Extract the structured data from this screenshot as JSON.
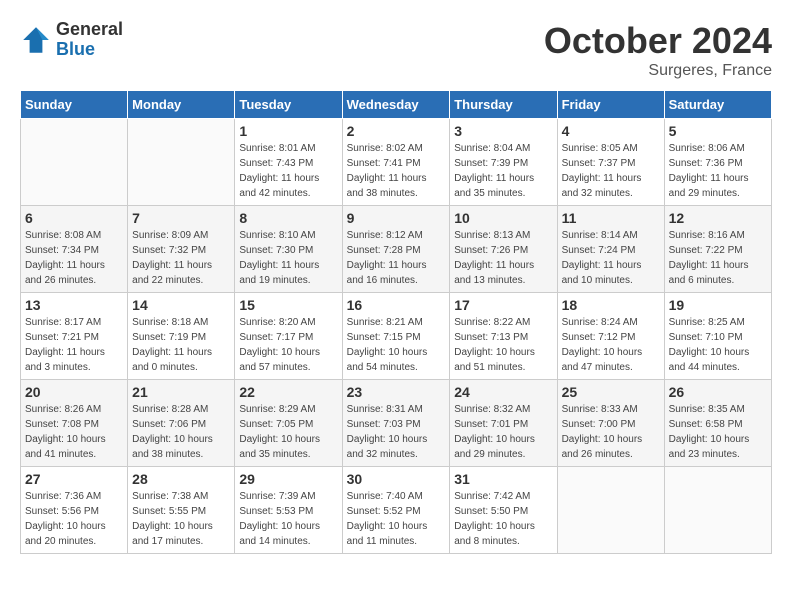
{
  "header": {
    "logo_line1": "General",
    "logo_line2": "Blue",
    "month": "October 2024",
    "location": "Surgeres, France"
  },
  "days_of_week": [
    "Sunday",
    "Monday",
    "Tuesday",
    "Wednesday",
    "Thursday",
    "Friday",
    "Saturday"
  ],
  "weeks": [
    [
      {
        "day": "",
        "info": ""
      },
      {
        "day": "",
        "info": ""
      },
      {
        "day": "1",
        "info": "Sunrise: 8:01 AM\nSunset: 7:43 PM\nDaylight: 11 hours and 42 minutes."
      },
      {
        "day": "2",
        "info": "Sunrise: 8:02 AM\nSunset: 7:41 PM\nDaylight: 11 hours and 38 minutes."
      },
      {
        "day": "3",
        "info": "Sunrise: 8:04 AM\nSunset: 7:39 PM\nDaylight: 11 hours and 35 minutes."
      },
      {
        "day": "4",
        "info": "Sunrise: 8:05 AM\nSunset: 7:37 PM\nDaylight: 11 hours and 32 minutes."
      },
      {
        "day": "5",
        "info": "Sunrise: 8:06 AM\nSunset: 7:36 PM\nDaylight: 11 hours and 29 minutes."
      }
    ],
    [
      {
        "day": "6",
        "info": "Sunrise: 8:08 AM\nSunset: 7:34 PM\nDaylight: 11 hours and 26 minutes."
      },
      {
        "day": "7",
        "info": "Sunrise: 8:09 AM\nSunset: 7:32 PM\nDaylight: 11 hours and 22 minutes."
      },
      {
        "day": "8",
        "info": "Sunrise: 8:10 AM\nSunset: 7:30 PM\nDaylight: 11 hours and 19 minutes."
      },
      {
        "day": "9",
        "info": "Sunrise: 8:12 AM\nSunset: 7:28 PM\nDaylight: 11 hours and 16 minutes."
      },
      {
        "day": "10",
        "info": "Sunrise: 8:13 AM\nSunset: 7:26 PM\nDaylight: 11 hours and 13 minutes."
      },
      {
        "day": "11",
        "info": "Sunrise: 8:14 AM\nSunset: 7:24 PM\nDaylight: 11 hours and 10 minutes."
      },
      {
        "day": "12",
        "info": "Sunrise: 8:16 AM\nSunset: 7:22 PM\nDaylight: 11 hours and 6 minutes."
      }
    ],
    [
      {
        "day": "13",
        "info": "Sunrise: 8:17 AM\nSunset: 7:21 PM\nDaylight: 11 hours and 3 minutes."
      },
      {
        "day": "14",
        "info": "Sunrise: 8:18 AM\nSunset: 7:19 PM\nDaylight: 11 hours and 0 minutes."
      },
      {
        "day": "15",
        "info": "Sunrise: 8:20 AM\nSunset: 7:17 PM\nDaylight: 10 hours and 57 minutes."
      },
      {
        "day": "16",
        "info": "Sunrise: 8:21 AM\nSunset: 7:15 PM\nDaylight: 10 hours and 54 minutes."
      },
      {
        "day": "17",
        "info": "Sunrise: 8:22 AM\nSunset: 7:13 PM\nDaylight: 10 hours and 51 minutes."
      },
      {
        "day": "18",
        "info": "Sunrise: 8:24 AM\nSunset: 7:12 PM\nDaylight: 10 hours and 47 minutes."
      },
      {
        "day": "19",
        "info": "Sunrise: 8:25 AM\nSunset: 7:10 PM\nDaylight: 10 hours and 44 minutes."
      }
    ],
    [
      {
        "day": "20",
        "info": "Sunrise: 8:26 AM\nSunset: 7:08 PM\nDaylight: 10 hours and 41 minutes."
      },
      {
        "day": "21",
        "info": "Sunrise: 8:28 AM\nSunset: 7:06 PM\nDaylight: 10 hours and 38 minutes."
      },
      {
        "day": "22",
        "info": "Sunrise: 8:29 AM\nSunset: 7:05 PM\nDaylight: 10 hours and 35 minutes."
      },
      {
        "day": "23",
        "info": "Sunrise: 8:31 AM\nSunset: 7:03 PM\nDaylight: 10 hours and 32 minutes."
      },
      {
        "day": "24",
        "info": "Sunrise: 8:32 AM\nSunset: 7:01 PM\nDaylight: 10 hours and 29 minutes."
      },
      {
        "day": "25",
        "info": "Sunrise: 8:33 AM\nSunset: 7:00 PM\nDaylight: 10 hours and 26 minutes."
      },
      {
        "day": "26",
        "info": "Sunrise: 8:35 AM\nSunset: 6:58 PM\nDaylight: 10 hours and 23 minutes."
      }
    ],
    [
      {
        "day": "27",
        "info": "Sunrise: 7:36 AM\nSunset: 5:56 PM\nDaylight: 10 hours and 20 minutes."
      },
      {
        "day": "28",
        "info": "Sunrise: 7:38 AM\nSunset: 5:55 PM\nDaylight: 10 hours and 17 minutes."
      },
      {
        "day": "29",
        "info": "Sunrise: 7:39 AM\nSunset: 5:53 PM\nDaylight: 10 hours and 14 minutes."
      },
      {
        "day": "30",
        "info": "Sunrise: 7:40 AM\nSunset: 5:52 PM\nDaylight: 10 hours and 11 minutes."
      },
      {
        "day": "31",
        "info": "Sunrise: 7:42 AM\nSunset: 5:50 PM\nDaylight: 10 hours and 8 minutes."
      },
      {
        "day": "",
        "info": ""
      },
      {
        "day": "",
        "info": ""
      }
    ]
  ]
}
